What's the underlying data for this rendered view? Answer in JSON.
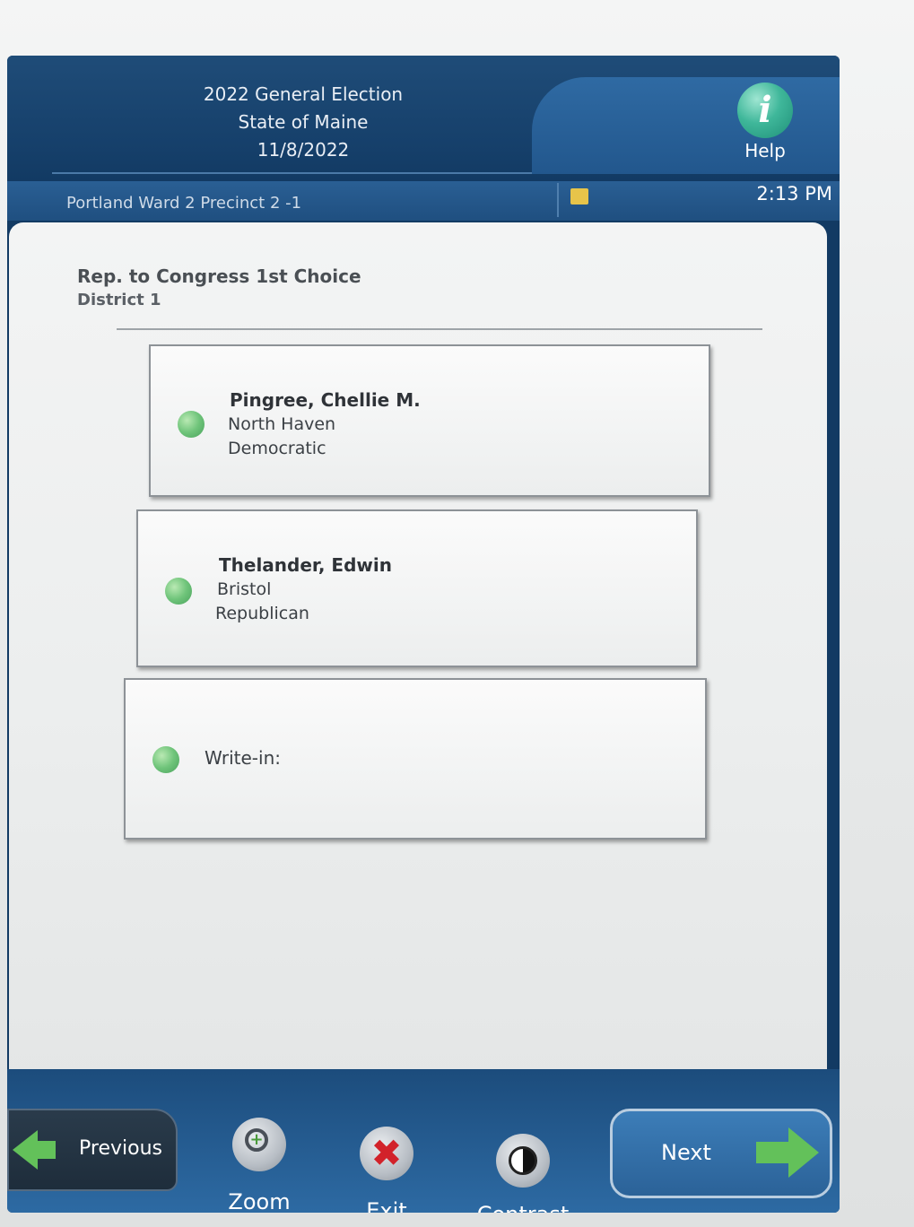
{
  "header": {
    "election_name": "2022 General Election",
    "state": "State of Maine",
    "date": "11/8/2022",
    "help_label": "Help",
    "help_icon": "info-icon"
  },
  "status": {
    "precinct": "Portland Ward 2 Precinct 2 -1",
    "time": "2:13 PM",
    "note_icon": "note-icon"
  },
  "contest": {
    "title": "Rep. to Congress 1st Choice",
    "district": "District 1",
    "choices": [
      {
        "name": "Pingree, Chellie M.",
        "town": "North Haven",
        "party": "Democratic"
      },
      {
        "name": "Thelander, Edwin",
        "town": "Bristol",
        "party": "Republican"
      }
    ],
    "writein_label": "Write-in:"
  },
  "footer": {
    "previous_label": "Previous",
    "zoom_label": "Zoom",
    "exit_label": "Exit",
    "contrast_label": "Contrast",
    "next_label": "Next"
  },
  "colors": {
    "screen_blue": "#123a63",
    "button_blue": "#2b6298",
    "selection_green": "#6fc47a",
    "exit_red": "#d2222a"
  }
}
